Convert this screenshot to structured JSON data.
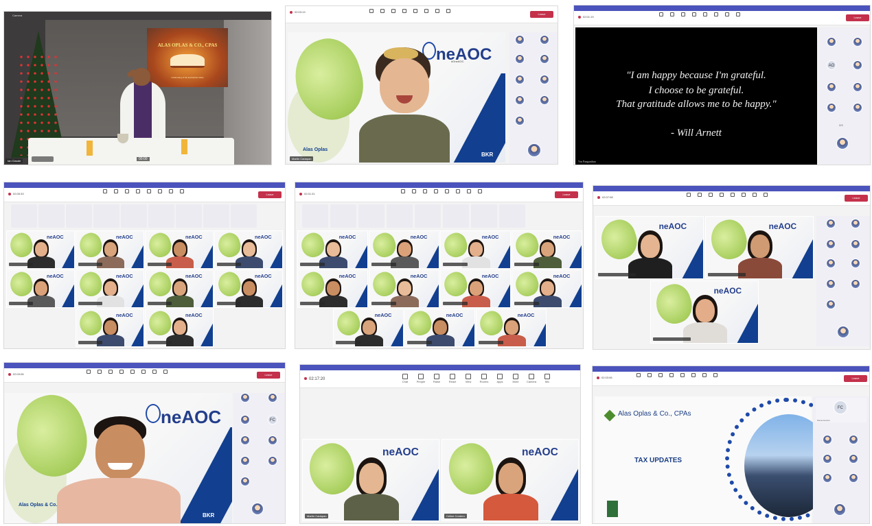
{
  "panel1": {
    "banner_title": "ALAS OPLAS & CO., CPAS",
    "banner_caption": "Celebrating of the Eucharistic Mass",
    "corner_label": "Camera",
    "name_label": "Ian Claude",
    "timer": "00:00"
  },
  "panel2": {
    "brand": "neAOC",
    "brand_sub": "#OneAOC",
    "company": "Alas Oplas",
    "firm": "BKR",
    "name_label": "Martin Cadapan",
    "timer": "02:03:13"
  },
  "panel3": {
    "quote_line1": "\"I am happy because I'm grateful.",
    "quote_line2": "I choose to be grateful.",
    "quote_line3": "That gratitude allows me to be happy.\"",
    "quote_author": "- Will Arnett",
    "presenter": "Ym Panganiban",
    "timer": "02:01:19",
    "leave": "Leave",
    "avatar_ao": "AO",
    "pager": "2/3"
  },
  "panel4": {
    "timer": "02:05:33",
    "leave": "Leave"
  },
  "panel5": {
    "timer": "02:01:31",
    "leave": "Leave"
  },
  "panel6": {
    "timer": "02:07:08",
    "leave": "Leave"
  },
  "panel7": {
    "timer": "02:03:06",
    "leave": "Leave",
    "brand": "neAOC",
    "company": "Alas Oplas & Co.",
    "firm": "BKR",
    "fc": "FC"
  },
  "panel8": {
    "timer": "02:17:20",
    "leave": "Leave",
    "brand": "neAOC",
    "firm": "BKR",
    "name_left": "Martin Cadapan",
    "name_right": "Celine Cordero",
    "tools": [
      "Chat",
      "People",
      "Raise",
      "React",
      "View",
      "Rooms",
      "Apps",
      "More",
      "Camera",
      "Mic"
    ]
  },
  "panel9": {
    "timer": "02:03:06",
    "leave": "Leave",
    "firm_name": "Alas Oplas & Co., CPAs",
    "slide_title": "TAX UPDATES",
    "fc": "FC",
    "fc_label": "Fiona Cenzon"
  },
  "tool_labels": [
    "Chat",
    "People",
    "Raise",
    "React",
    "View",
    "Rooms",
    "Apps",
    "More"
  ],
  "colors": {
    "teams_purple": "#4b53bc",
    "leave_red": "#c4314b",
    "aoc_blue": "#123f8f",
    "leaf_green": "#a9cf5f"
  }
}
